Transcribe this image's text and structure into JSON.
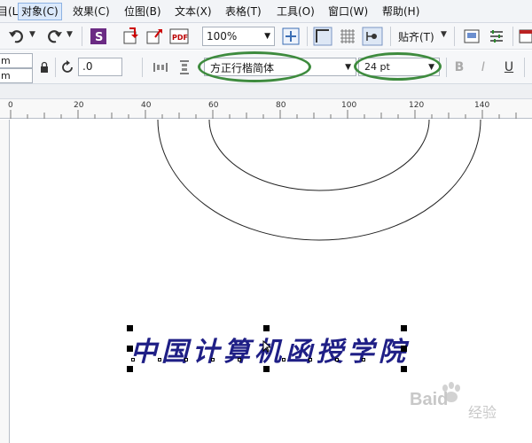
{
  "menu": {
    "items": [
      "目(L)",
      "对象(C)",
      "效果(C)",
      "位图(B)",
      "文本(X)",
      "表格(T)",
      "工具(O)",
      "窗口(W)",
      "帮助(H)"
    ]
  },
  "toolbar": {
    "zoom": "100%",
    "snap_label": "贴齐(T)"
  },
  "property_bar": {
    "unit_top": "m",
    "unit_bottom": "m",
    "rotation": ".0",
    "font_name": "方正行楷简体",
    "font_size": "24 pt",
    "bold_label": "B",
    "italic_label": "I",
    "underline_label": "U"
  },
  "ruler": {
    "ticks": [
      "0",
      "20",
      "40",
      "60",
      "80",
      "100",
      "120",
      "140"
    ]
  },
  "canvas": {
    "text": "中国计算机函授学院"
  },
  "watermark": {
    "brand": "Baid",
    "sub": "经验"
  },
  "colors": {
    "highlight_oval": "#3e8b3e",
    "text_fill": "#1f1f86",
    "menu_active_bg": "#dbe9fb"
  }
}
